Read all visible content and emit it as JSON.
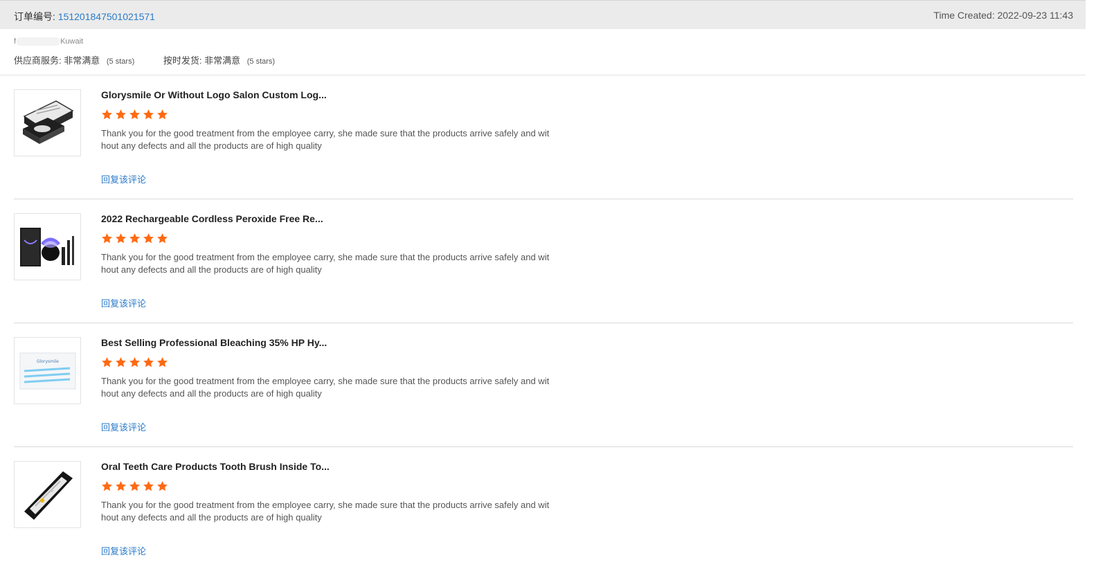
{
  "header": {
    "order_label": "订单编号:",
    "order_number": "151201847501021571",
    "time_created": "Time Created: 2022-09-23 11:43"
  },
  "buyer": {
    "name_start": "f",
    "country": "Kuwait"
  },
  "ratings": [
    {
      "label": "供应商服务:",
      "value": "非常满意",
      "note": "(5 stars)"
    },
    {
      "label": "按时发货:",
      "value": "非常满意",
      "note": "(5 stars)"
    }
  ],
  "colors": {
    "star": "#ff6a13",
    "link": "#2a7bc9",
    "header_bg": "#ebebeb"
  },
  "reviews": [
    {
      "title": "Glorysmile Or Without Logo Salon Custom Log...",
      "stars": 5,
      "comment": "Thank you for the good treatment from the employee carry, she made sure that the products arrive safely and without any defects and all the products are of high quality",
      "reply": "回复该评论"
    },
    {
      "title": "2022 Rechargeable Cordless Peroxide Free Re...",
      "stars": 5,
      "comment": "Thank you for the good treatment from the employee carry, she made sure that the products arrive safely and without any defects and all the products are of high quality",
      "reply": "回复该评论"
    },
    {
      "title": "Best Selling Professional Bleaching 35% HP Hy...",
      "stars": 5,
      "comment": "Thank you for the good treatment from the employee carry, she made sure that the products arrive safely and without any defects and all the products are of high quality",
      "reply": "回复该评论"
    },
    {
      "title": "Oral Teeth Care Products Tooth Brush Inside To...",
      "stars": 5,
      "comment": "Thank you for the good treatment from the employee carry, she made sure that the products arrive safely and without any defects and all the products are of high quality",
      "reply": "回复该评论"
    }
  ]
}
